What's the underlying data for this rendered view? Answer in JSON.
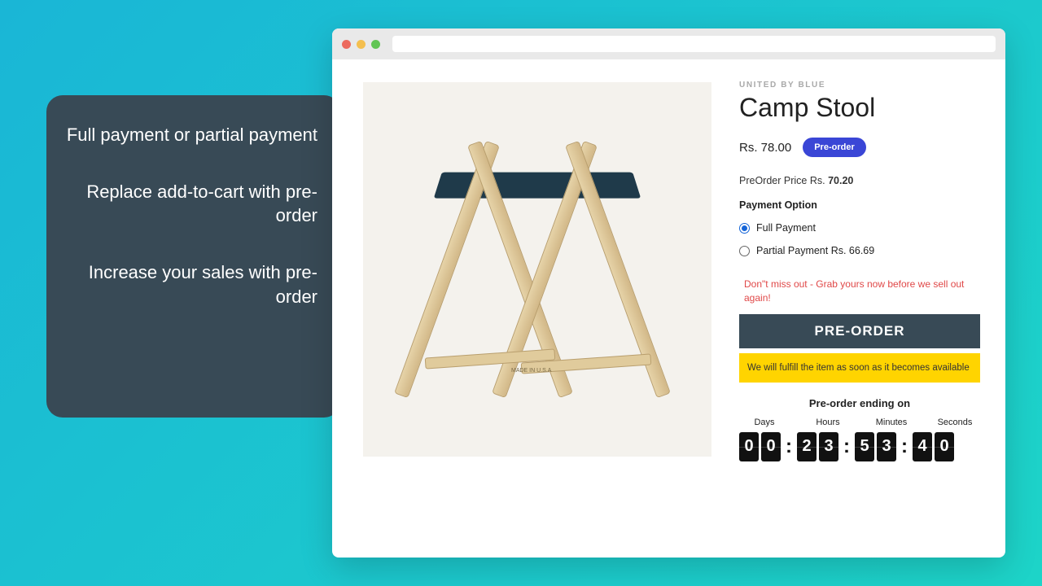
{
  "callout": {
    "line1": "Full payment or partial payment",
    "line2": "Replace add-to-cart with pre-order",
    "line3": "Increase your sales with pre-order"
  },
  "window": {
    "traffic_red": "#ec6a5e",
    "traffic_yellow": "#f4bf4f",
    "traffic_green": "#61c554"
  },
  "product": {
    "brand": "UNITED BY BLUE",
    "title": "Camp Stool",
    "price": "Rs. 78.00",
    "badge": "Pre-order",
    "preorder_price_label": "PreOrder Price Rs.",
    "preorder_price_value": "70.20",
    "payment_option_heading": "Payment Option",
    "full_payment_label": "Full Payment",
    "partial_payment_label": "Partial Payment Rs. 66.69",
    "warning": "Don\"t miss out - Grab yours now before we sell out again!",
    "button": "PRE-ORDER",
    "fulfillment": "We will fulfill the item as soon as it becomes available",
    "ending_label": "Pre-order ending on",
    "made_label": "MADE IN U.S.A"
  },
  "countdown": {
    "labels": {
      "days": "Days",
      "hours": "Hours",
      "minutes": "Minutes",
      "seconds": "Seconds"
    },
    "days": [
      "0",
      "0"
    ],
    "hours": [
      "2",
      "3"
    ],
    "minutes": [
      "5",
      "3"
    ],
    "seconds": [
      "4",
      "0"
    ]
  }
}
